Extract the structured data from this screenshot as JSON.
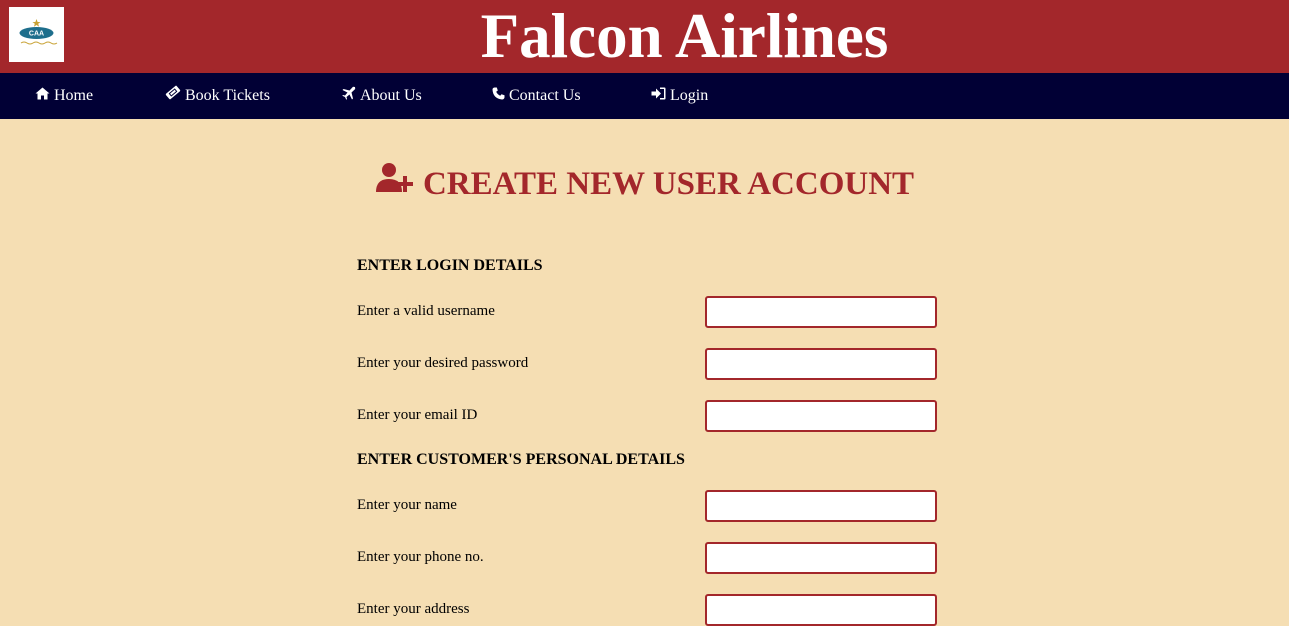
{
  "header": {
    "logo_text": "CAA",
    "title": "Falcon Airlines"
  },
  "nav": {
    "items": [
      {
        "label": "Home",
        "icon": "home-icon"
      },
      {
        "label": "Book Tickets",
        "icon": "ticket-icon"
      },
      {
        "label": "About Us",
        "icon": "plane-icon"
      },
      {
        "label": "Contact Us",
        "icon": "phone-icon"
      },
      {
        "label": "Login",
        "icon": "sign-in-icon"
      }
    ]
  },
  "main": {
    "heading": "CREATE NEW USER ACCOUNT",
    "heading_icon": "user-plus-icon",
    "sections": [
      {
        "title": "ENTER LOGIN DETAILS",
        "fields": [
          {
            "label": "Enter a valid username",
            "value": ""
          },
          {
            "label": "Enter your desired password",
            "value": ""
          },
          {
            "label": "Enter your email ID",
            "value": ""
          }
        ]
      },
      {
        "title": "ENTER CUSTOMER'S PERSONAL DETAILS",
        "fields": [
          {
            "label": "Enter your name",
            "value": ""
          },
          {
            "label": "Enter your phone no.",
            "value": ""
          },
          {
            "label": "Enter your address",
            "value": ""
          }
        ]
      }
    ]
  },
  "colors": {
    "header_bg": "#a3272b",
    "nav_bg": "#010035",
    "page_bg": "#f5deb3",
    "accent": "#a3272b"
  }
}
